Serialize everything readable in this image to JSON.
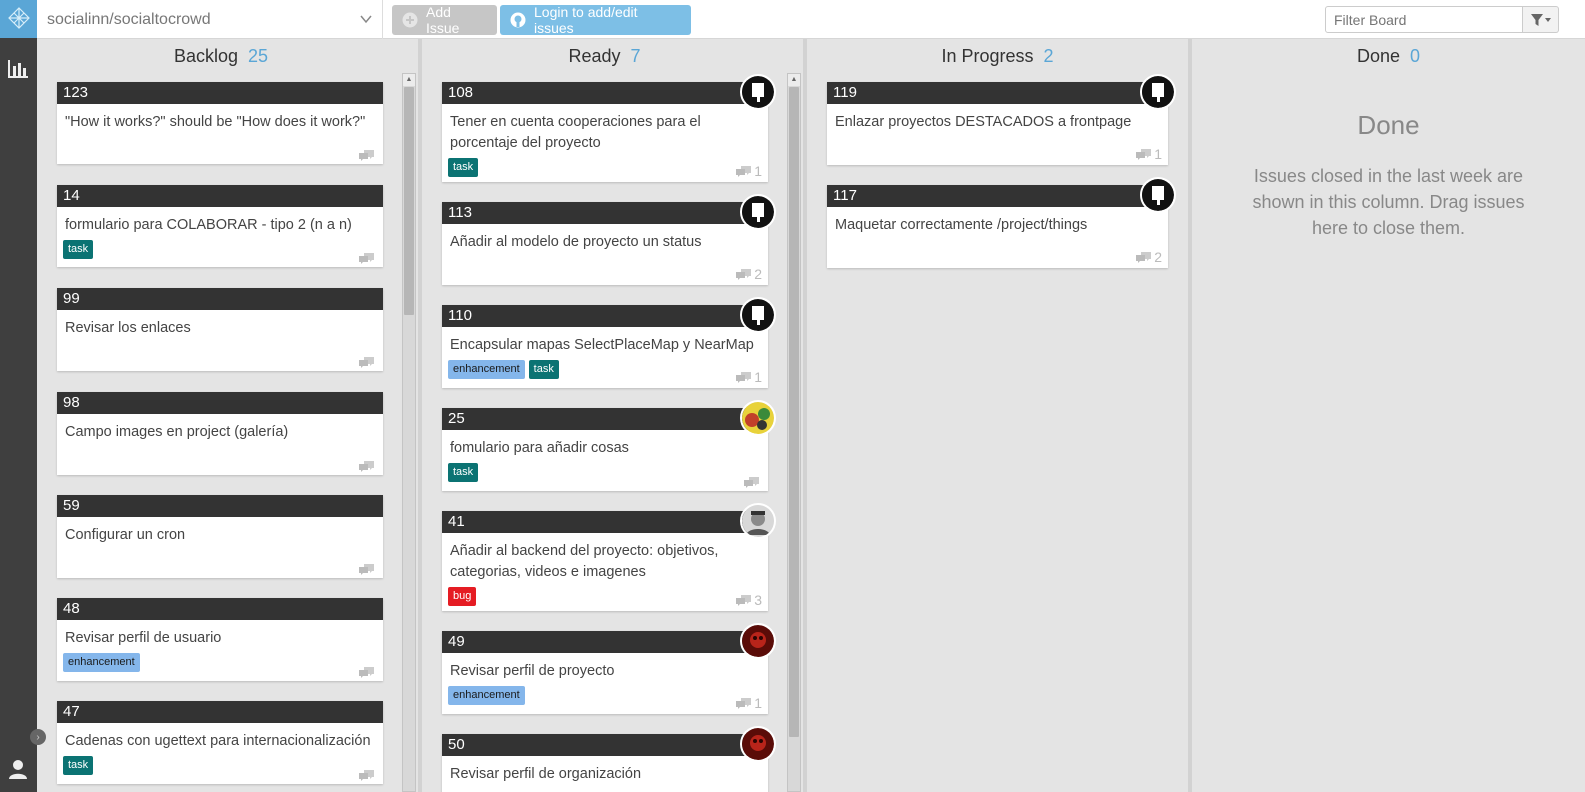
{
  "repo": {
    "name": "socialinn/socialtocrowd"
  },
  "toolbar": {
    "add_issue": "Add Issue",
    "login": "Login to add/edit issues"
  },
  "filter": {
    "placeholder": "Filter Board"
  },
  "colors": {
    "accent": "#5aa6d6",
    "task": "#0b7373",
    "enhancement": "#84b6eb",
    "bug": "#e51c23"
  },
  "columns": {
    "backlog": {
      "title": "Backlog",
      "count": "25",
      "cards": [
        {
          "num": "123",
          "title": "\"How it works?\" should be \"How does it work?\"",
          "labels": [],
          "comments": ""
        },
        {
          "num": "14",
          "title": "formulario para COLABORAR - tipo 2 (n a n)",
          "labels": [
            "task"
          ],
          "comments": ""
        },
        {
          "num": "99",
          "title": "Revisar los enlaces",
          "labels": [],
          "comments": ""
        },
        {
          "num": "98",
          "title": "Campo images en project (galería)",
          "labels": [],
          "comments": ""
        },
        {
          "num": "59",
          "title": "Configurar un cron",
          "labels": [],
          "comments": ""
        },
        {
          "num": "48",
          "title": "Revisar perfil de usuario",
          "labels": [
            "enhancement"
          ],
          "comments": ""
        },
        {
          "num": "47",
          "title": "Cadenas con ugettext para internacionalización",
          "labels": [
            "task"
          ],
          "comments": ""
        }
      ]
    },
    "ready": {
      "title": "Ready",
      "count": "7",
      "cards": [
        {
          "num": "108",
          "title": "Tener en cuenta cooperaciones para el porcentaje del proyecto",
          "labels": [
            "task"
          ],
          "comments": "1",
          "avatar": "flag-avatar"
        },
        {
          "num": "113",
          "title": "Añadir al modelo de proyecto un status",
          "labels": [],
          "comments": "2",
          "avatar": "flag-avatar"
        },
        {
          "num": "110",
          "title": "Encapsular mapas SelectPlaceMap y NearMap",
          "labels": [
            "enhancement",
            "task"
          ],
          "comments": "1",
          "avatar": "flag-avatar"
        },
        {
          "num": "25",
          "title": "fomulario para añadir cosas",
          "labels": [
            "task"
          ],
          "comments": "",
          "avatar": "colorful-avatar"
        },
        {
          "num": "41",
          "title": "Añadir al backend del proyecto: objetivos, categorias, videos e imagenes",
          "labels": [
            "bug"
          ],
          "comments": "3",
          "avatar": "face-avatar"
        },
        {
          "num": "49",
          "title": "Revisar perfil de proyecto",
          "labels": [
            "enhancement"
          ],
          "comments": "1",
          "avatar": "red-avatar"
        },
        {
          "num": "50",
          "title": "Revisar perfil de organización",
          "labels": [],
          "comments": "",
          "avatar": "red-avatar"
        }
      ]
    },
    "in_progress": {
      "title": "In Progress",
      "count": "2",
      "cards": [
        {
          "num": "119",
          "title": "Enlazar proyectos DESTACADOS a frontpage",
          "labels": [],
          "comments": "1",
          "avatar": "flag-avatar"
        },
        {
          "num": "117",
          "title": "Maquetar correctamente /project/things",
          "labels": [],
          "comments": "2",
          "avatar": "flag-avatar"
        }
      ]
    },
    "done": {
      "title": "Done",
      "count": "0",
      "empty_title": "Done",
      "empty_text": "Issues closed in the last week are shown in this column. Drag issues here to close them."
    }
  }
}
